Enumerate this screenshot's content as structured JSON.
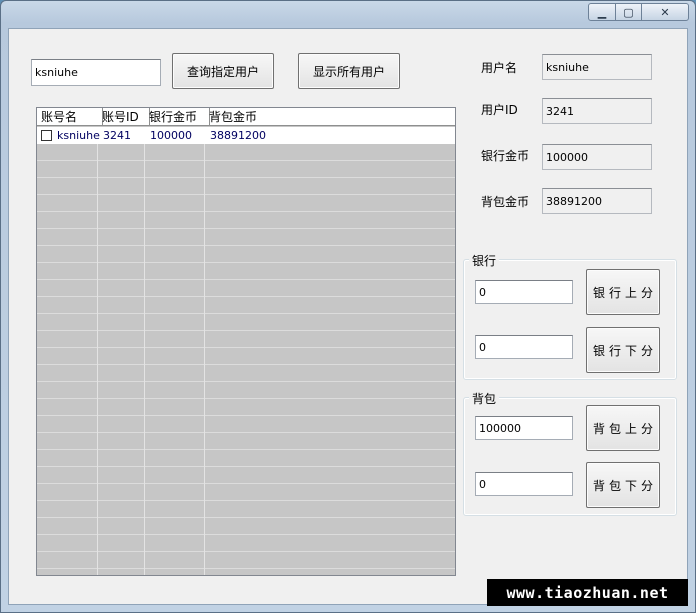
{
  "toolbar": {
    "search_value": "ksniuhe",
    "query_label": "查询指定用户",
    "show_all_label": "显示所有用户"
  },
  "list": {
    "columns": [
      "账号名",
      "账号ID",
      "银行金币",
      "背包金币"
    ],
    "rows": [
      {
        "name": "ksniuhe",
        "id": "3241",
        "bank": "100000",
        "bag": "38891200",
        "checked": false
      }
    ]
  },
  "info": {
    "username_label": "用户名",
    "username_value": "ksniuhe",
    "userid_label": "用户ID",
    "userid_value": "3241",
    "bank_label": "银行金币",
    "bank_value": "100000",
    "bag_label": "背包金币",
    "bag_value": "38891200"
  },
  "bank_group": {
    "title": "银行",
    "add_value": "0",
    "add_label": "银行上分",
    "sub_value": "0",
    "sub_label": "银行下分"
  },
  "bag_group": {
    "title": "背包",
    "add_value": "100000",
    "add_label": "背包上分",
    "sub_value": "0",
    "sub_label": "背包下分"
  },
  "watermark": "www.tiaozhuan.net",
  "window_buttons": {
    "min": "▁",
    "max": "▢",
    "close": "✕"
  }
}
